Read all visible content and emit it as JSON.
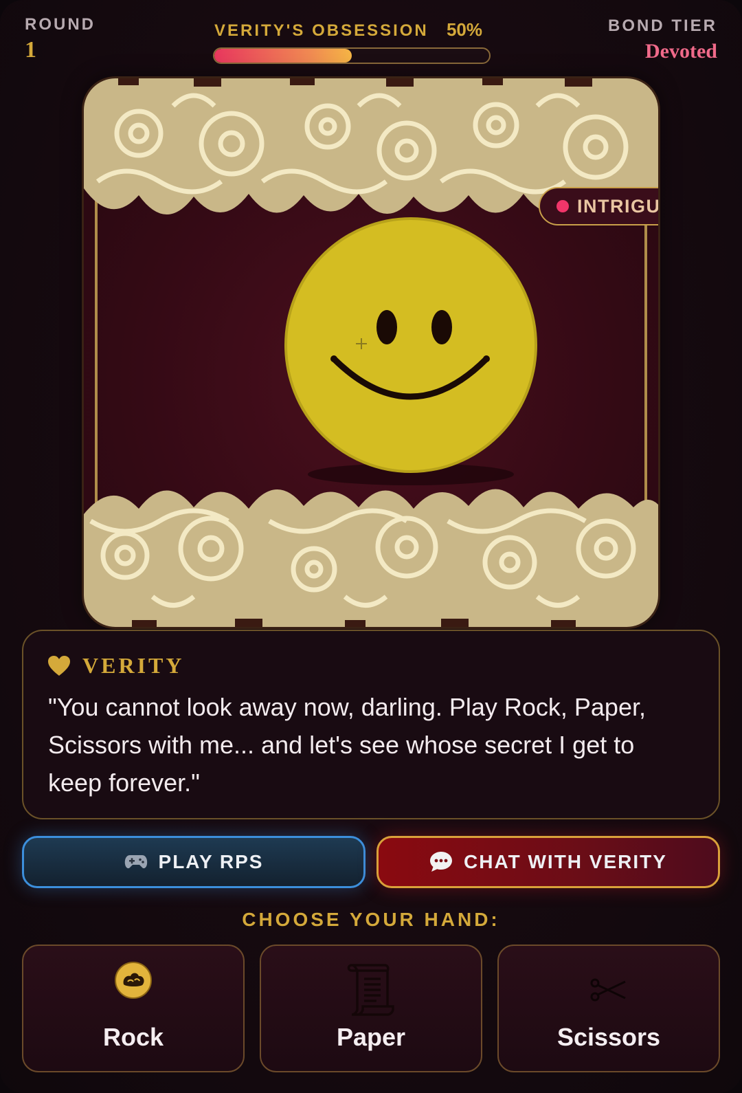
{
  "header": {
    "round_label": "ROUND",
    "round_value": "1",
    "obsession_label": "VERITY'S OBSESSION",
    "obsession_percent_text": "50%",
    "obsession_level": 0.5,
    "tier_label": "BOND TIER",
    "tier_value": "Devoted"
  },
  "portrait": {
    "status_text": "INTRIGUED",
    "status_dot_color": "#f0366a",
    "face_color": "#d4bd22"
  },
  "dialogue": {
    "speaker_icon": "heart-icon",
    "speaker": "VERITY",
    "text": "\"You cannot look away now, darling. Play Rock, Paper, Scissors with me... and let's see whose secret I get to keep forever.\""
  },
  "actions": {
    "play_icon": "gamepad-icon",
    "play_label": "PLAY RPS",
    "chat_icon": "speech-bubble-icon",
    "chat_label": "CHAT WITH VERITY"
  },
  "choose_label": "CHOOSE YOUR HAND:",
  "hands": [
    {
      "label": "Rock",
      "icon": "rock-icon"
    },
    {
      "label": "Paper",
      "icon": "scroll-icon"
    },
    {
      "label": "Scissors",
      "icon": "scissors-icon"
    }
  ],
  "colors": {
    "gold": "#d4a93a",
    "tier_pink": "#f06a8a",
    "play_blue": "#3c8fdc",
    "chat_red": "#8a0a10"
  }
}
